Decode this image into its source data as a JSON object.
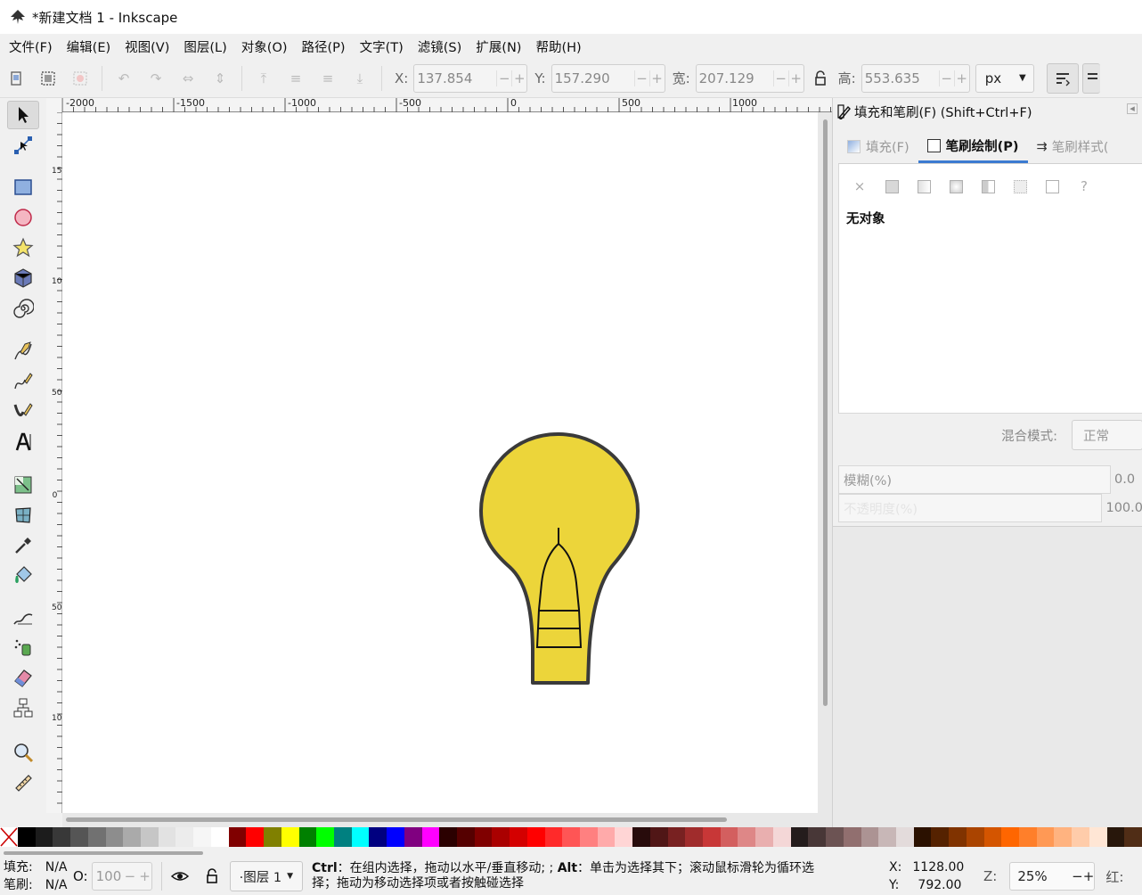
{
  "window": {
    "title": "*新建文档 1 - Inkscape"
  },
  "menu": [
    "文件(F)",
    "编辑(E)",
    "视图(V)",
    "图层(L)",
    "对象(O)",
    "路径(P)",
    "文字(T)",
    "滤镜(S)",
    "扩展(N)",
    "帮助(H)"
  ],
  "toolbar": {
    "x_label": "X:",
    "x_value": "137.854",
    "y_label": "Y:",
    "y_value": "157.290",
    "w_label": "宽:",
    "w_value": "207.129",
    "h_label": "高:",
    "h_value": "553.635",
    "unit": "px"
  },
  "ruler": {
    "labels": [
      "-2000",
      "-1500",
      "-1000",
      "-500",
      "0",
      "500",
      "1000"
    ],
    "vertical_labels": [
      "150",
      "100",
      "50",
      "0",
      "50",
      "100"
    ]
  },
  "dialog": {
    "title": "填充和笔刷(F) (Shift+Ctrl+F)",
    "tabs": [
      {
        "label": "填充(F)",
        "active": false
      },
      {
        "label": "笔刷绘制(P)",
        "active": true
      },
      {
        "label": "笔刷样式(",
        "active": false
      }
    ],
    "paint_x": "×",
    "paint_unknown": "?",
    "no_object": "无对象",
    "blend_label": "混合模式:",
    "blend_value": "正常",
    "blur_label": "模糊(%)",
    "blur_value": "0.0",
    "opacity_label": "不透明度(%)",
    "opacity_value": "100.0"
  },
  "palette": [
    "#000000",
    "#1c1c1c",
    "#383838",
    "#555555",
    "#717171",
    "#8d8d8d",
    "#aaaaaa",
    "#c6c6c6",
    "#e2e2e2",
    "#ececec",
    "#f6f6f6",
    "#ffffff",
    "#800000",
    "#ff0000",
    "#808000",
    "#ffff00",
    "#008000",
    "#00ff00",
    "#008080",
    "#00ffff",
    "#000080",
    "#0000ff",
    "#800080",
    "#ff00ff",
    "#2b0000",
    "#550000",
    "#800000",
    "#aa0000",
    "#d40000",
    "#ff0000",
    "#ff2a2a",
    "#ff5555",
    "#ff8080",
    "#ffaaaa",
    "#ffd5d5",
    "#280b0b",
    "#501616",
    "#782121",
    "#a02c2c",
    "#c83737",
    "#d35f5f",
    "#de8787",
    "#e9afaf",
    "#f4d7d7",
    "#241c1c",
    "#483737",
    "#6c5353",
    "#916f6f",
    "#ac9393",
    "#c8b7b7",
    "#e3dbdb",
    "#2b1100",
    "#552200",
    "#803300",
    "#aa4400",
    "#d45500",
    "#ff6600",
    "#ff7f2a",
    "#ff9955",
    "#ffb380",
    "#ffccaa",
    "#ffe6d5",
    "#28170b",
    "#502d16"
  ],
  "status": {
    "fill_label": "填充:",
    "fill_value": "N/A",
    "stroke_label": "笔刷:",
    "stroke_value": "N/A",
    "opacity_label": "O:",
    "opacity_value": "100",
    "layer": "·图层 1",
    "message_ctrl": "Ctrl",
    "message_alt": "Alt",
    "message_line1_a": "：在组内选择，拖动以水平/垂直移动; ; ",
    "message_line1_b": "：单击为选择其下；滚动鼠标滑轮为循环选",
    "message_line2": "择；拖动为移动选择项或者按触碰选择",
    "cursor_x_label": "X:",
    "cursor_x": "1128.00",
    "cursor_y_label": "Y:",
    "cursor_y": "792.00",
    "zoom_label": "Z:",
    "zoom": "25%",
    "rotate_label": "红:"
  },
  "colors": {
    "bulb_fill": "#ecd53a",
    "bulb_stroke": "#3a3a3a",
    "accent": "#3b7bd1"
  }
}
